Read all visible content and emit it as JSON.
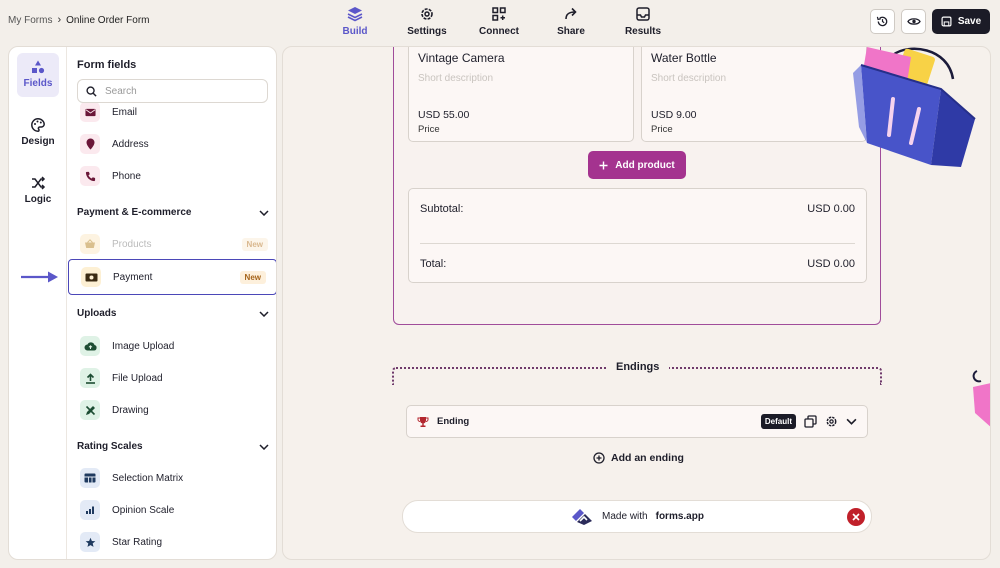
{
  "breadcrumb": {
    "parent": "My Forms",
    "separator": "›",
    "current": "Online Order Form"
  },
  "topnav": [
    {
      "id": "build",
      "label": "Build",
      "icon": "layers-icon",
      "active": true
    },
    {
      "id": "settings",
      "label": "Settings",
      "icon": "gear-icon",
      "active": false
    },
    {
      "id": "connect",
      "label": "Connect",
      "icon": "connect-icon",
      "active": false
    },
    {
      "id": "share",
      "label": "Share",
      "icon": "share-icon",
      "active": false
    },
    {
      "id": "results",
      "label": "Results",
      "icon": "inbox-icon",
      "active": false
    }
  ],
  "toolbar": {
    "save_label": "Save",
    "history_icon": "history-icon",
    "preview_icon": "eye-icon"
  },
  "rail": [
    {
      "label": "Fields",
      "icon": "shapes-icon",
      "active": true
    },
    {
      "label": "Design",
      "icon": "palette-icon",
      "active": false
    },
    {
      "label": "Logic",
      "icon": "shuffle-icon",
      "active": false
    }
  ],
  "fields_panel": {
    "title": "Form fields",
    "search_placeholder": "Search",
    "contact_items": [
      {
        "label": "Email",
        "icon": "mail-icon"
      },
      {
        "label": "Address",
        "icon": "location-pin-icon"
      },
      {
        "label": "Phone",
        "icon": "phone-icon"
      }
    ],
    "sections": [
      {
        "title": "Payment & E-commerce",
        "items": [
          {
            "label": "Products",
            "icon": "basket-icon",
            "badge": "New",
            "disabled": true
          },
          {
            "label": "Payment",
            "icon": "cash-icon",
            "badge": "New",
            "selected": true
          }
        ]
      },
      {
        "title": "Uploads",
        "items": [
          {
            "label": "Image Upload",
            "icon": "cloud-upload-icon"
          },
          {
            "label": "File Upload",
            "icon": "upload-icon"
          },
          {
            "label": "Drawing",
            "icon": "pen-ruler-icon"
          }
        ]
      },
      {
        "title": "Rating Scales",
        "items": [
          {
            "label": "Selection Matrix",
            "icon": "matrix-icon"
          },
          {
            "label": "Opinion Scale",
            "icon": "bar-scale-icon"
          },
          {
            "label": "Star Rating",
            "icon": "star-icon"
          }
        ]
      }
    ]
  },
  "form": {
    "products": [
      {
        "name": "Vintage Camera",
        "description": "Short description",
        "price": "USD 55.00",
        "price_label": "Price"
      },
      {
        "name": "Water Bottle",
        "description": "Short description",
        "price": "USD 9.00",
        "price_label": "Price"
      }
    ],
    "add_product_label": "Add product",
    "subtotal_label": "Subtotal:",
    "subtotal_value": "USD 0.00",
    "total_label": "Total:",
    "total_value": "USD 0.00"
  },
  "endings": {
    "section_label": "Endings",
    "ending_label": "Ending",
    "default_badge": "Default",
    "add_ending_label": "Add an ending"
  },
  "branding": {
    "prefix": "Made with",
    "brand": "forms.app"
  },
  "colors": {
    "accent": "#5b57c9",
    "product_button": "#a4338f",
    "dark": "#1b1b27",
    "close_red": "#c0202a"
  }
}
